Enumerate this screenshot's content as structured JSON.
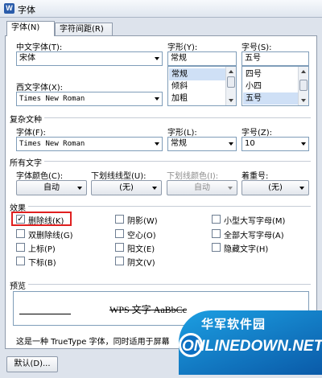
{
  "window": {
    "app_icon": "W",
    "title": "字体"
  },
  "tabs": [
    {
      "label": "字体(N)"
    },
    {
      "label": "字符间距(R)"
    }
  ],
  "font": {
    "chinese_label": "中文字体(T):",
    "chinese_value": "宋体",
    "western_label": "西文字体(X):",
    "western_value": "Times New Roman",
    "style_label": "字形(Y):",
    "style_value": "常规",
    "style_options": [
      "常规",
      "倾斜",
      "加粗"
    ],
    "size_label": "字号(S):",
    "size_value": "五号",
    "size_options": [
      "四号",
      "小四",
      "五号"
    ]
  },
  "complex": {
    "group": "复杂文种",
    "font_label": "字体(F):",
    "font_value": "Times New Roman",
    "style_label": "字形(L):",
    "style_value": "常规",
    "size_label": "字号(Z):",
    "size_value": "10"
  },
  "all_text": {
    "group": "所有文字",
    "color_label": "字体颜色(C):",
    "color_value": "自动",
    "underline_label": "下划线线型(U):",
    "underline_value": "(无)",
    "underline_color_label": "下划线颜色(I):",
    "underline_color_value": "自动",
    "emphasis_label": "着重号:",
    "emphasis_value": "(无)"
  },
  "effects": {
    "group": "效果",
    "items": [
      {
        "label": "删除线(K)",
        "checked": true,
        "mark": "✓"
      },
      {
        "label": "双删除线(G)",
        "checked": false,
        "mark": ""
      },
      {
        "label": "上标(P)",
        "checked": false,
        "mark": ""
      },
      {
        "label": "下标(B)",
        "checked": false,
        "mark": ""
      },
      {
        "label": "阴影(W)",
        "checked": false,
        "mark": ""
      },
      {
        "label": "空心(O)",
        "checked": false,
        "mark": ""
      },
      {
        "label": "阳文(E)",
        "checked": false,
        "mark": ""
      },
      {
        "label": "阴文(V)",
        "checked": false,
        "mark": ""
      },
      {
        "label": "小型大写字母(M)",
        "checked": false,
        "mark": ""
      },
      {
        "label": "全部大写字母(A)",
        "checked": false,
        "mark": ""
      },
      {
        "label": "隐藏文字(H)",
        "checked": false,
        "mark": ""
      }
    ]
  },
  "preview": {
    "group": "预览",
    "sample": "WPS 文字 AaBbCc",
    "description": "这是一种 TrueType 字体，同时适用于屏幕"
  },
  "footer": {
    "default_button": "默认(D)..."
  },
  "watermark": {
    "site": "华军软件园",
    "brand": "ONLINEDOWN.NET"
  },
  "colors": {
    "highlight": "#e02020",
    "selection": "#cfe0f6",
    "watermark": "#1c9fe2"
  }
}
